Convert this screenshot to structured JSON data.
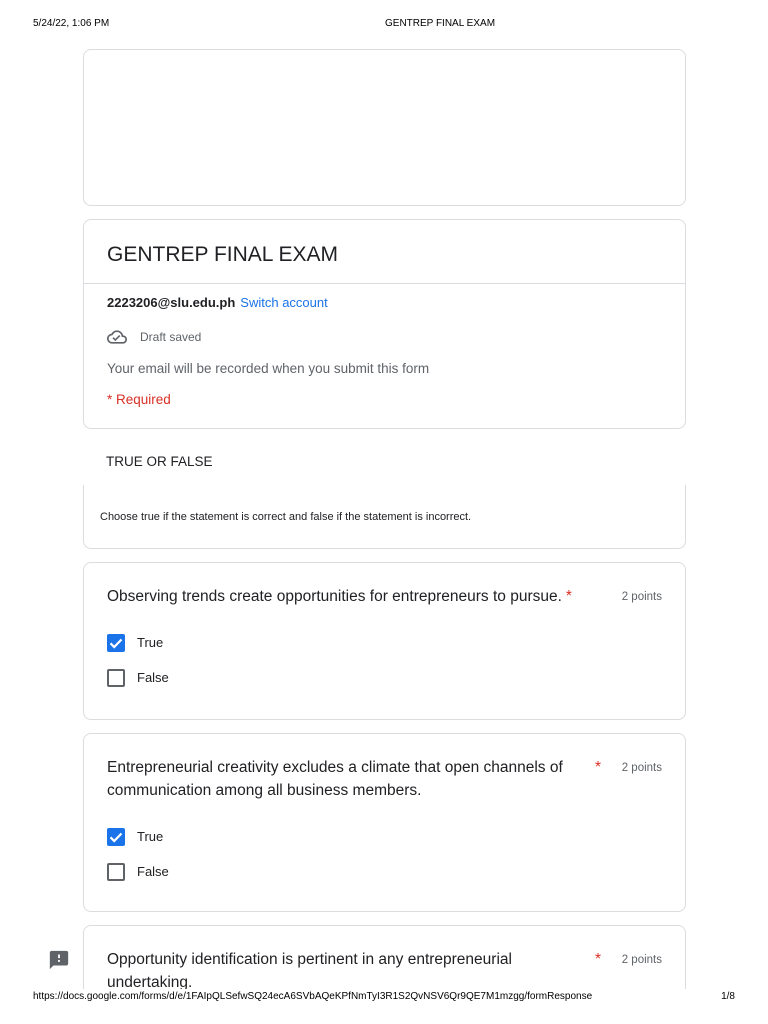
{
  "print_header": {
    "datetime": "5/24/22, 1:06 PM",
    "title": "GENTREP FINAL EXAM"
  },
  "form": {
    "title": "GENTREP FINAL EXAM",
    "account": {
      "email": "2223206@slu.edu.ph",
      "switch_label": "Switch account"
    },
    "draft_status": {
      "icon": "cloud-check-icon",
      "text": "Draft saved"
    },
    "email_notice": "Your email will be recorded when you submit this form",
    "required_note": "* Required"
  },
  "section": {
    "title": "TRUE OR FALSE",
    "description": "Choose true if the statement is correct and false if the statement is incorrect."
  },
  "questions": [
    {
      "text": "Observing trends create opportunities for entrepreneurs to pursue.",
      "required_mark": "*",
      "points": "2 points",
      "options": [
        {
          "label": "True",
          "checked": true
        },
        {
          "label": "False",
          "checked": false
        }
      ]
    },
    {
      "text": "Entrepreneurial creativity excludes a climate that open channels of communication among all business members.",
      "required_mark": "*",
      "points": "2 points",
      "options": [
        {
          "label": "True",
          "checked": true
        },
        {
          "label": "False",
          "checked": false
        }
      ]
    },
    {
      "text": "Opportunity identification is pertinent in any entrepreneurial undertaking.",
      "required_mark": "*",
      "points": "2 points"
    }
  ],
  "feedback_button": {
    "icon": "feedback-icon"
  },
  "print_footer": {
    "url": "https://docs.google.com/forms/d/e/1FAIpQLSefwSQ24ecA6SVbAQeKPfNmTyI3R1S2QvNSV6Qr9QE7M1mzgg/formResponse",
    "page": "1/8"
  },
  "colors": {
    "text": "#202124",
    "secondary_text": "#5f6368",
    "link": "#1a73e8",
    "checkbox_checked": "#1a73e8",
    "required": "#d93025",
    "card_border": "#dadce0"
  }
}
